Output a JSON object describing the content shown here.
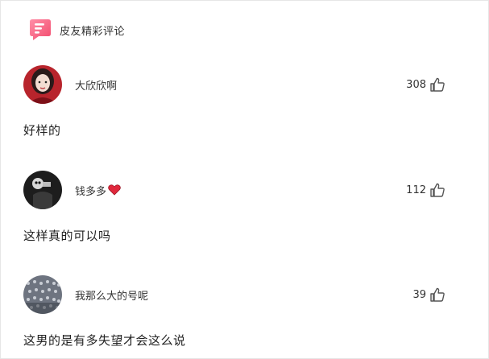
{
  "header": {
    "title": "皮友精彩评论",
    "logo_icon": "speech-bubble-logo",
    "brand_color": "#f4506e"
  },
  "comments": [
    {
      "username": "大欣欣啊",
      "likes": "308",
      "text": "好样的",
      "avatar_icon": "avatar-girl-red"
    },
    {
      "username": "钱多多",
      "likes": "112",
      "text": "这样真的可以吗",
      "avatar_icon": "avatar-dark-ghost",
      "badge_icon": "red-heart-icon"
    },
    {
      "username": "我那么大的号呢",
      "likes": "39",
      "text": "这男的是有多失望才会这么说",
      "avatar_icon": "avatar-crowd-grey"
    }
  ]
}
